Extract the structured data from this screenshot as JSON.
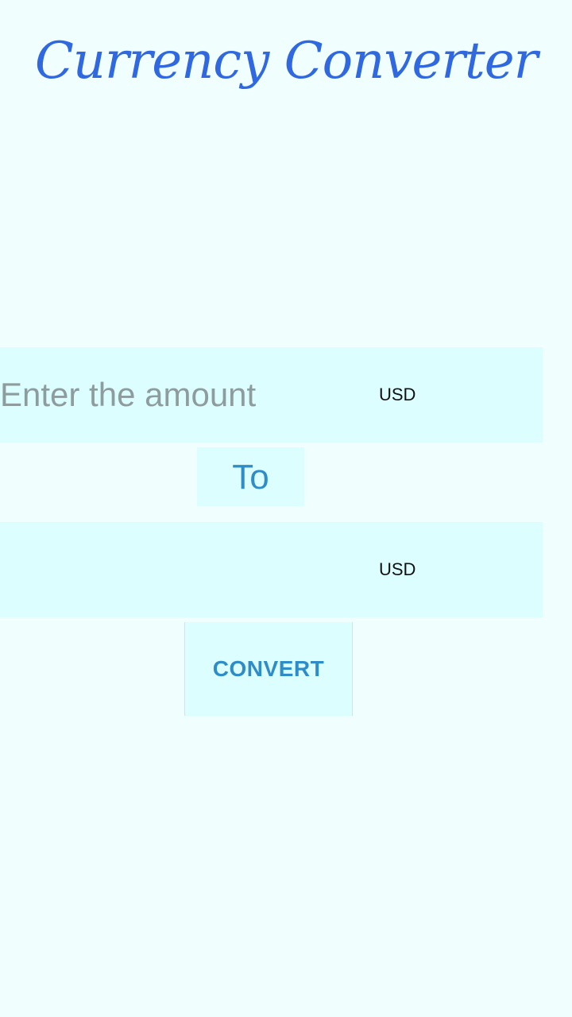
{
  "app": {
    "title": "Currency Converter"
  },
  "from": {
    "amount_value": "",
    "amount_placeholder": "Enter the amount",
    "currency": "USD"
  },
  "separator": {
    "label": "To"
  },
  "to": {
    "result_value": "",
    "currency": "USD"
  },
  "actions": {
    "convert_label": "CONVERT"
  },
  "colors": {
    "background": "#f0fffe",
    "field_background": "#dcfeff",
    "title": "#2f68e0",
    "accent": "#2e8dc8",
    "placeholder": "#8e9c9e"
  }
}
